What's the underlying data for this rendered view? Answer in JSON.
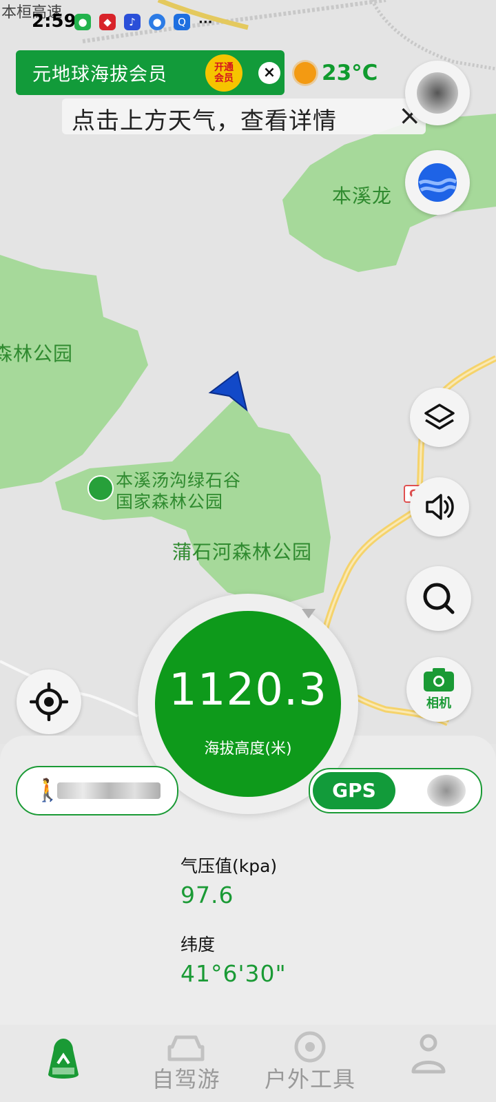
{
  "status_bar": {
    "time": "2:59",
    "more": "···",
    "icons": [
      "wechat-icon",
      "app-red-icon",
      "music-icon",
      "browser-icon",
      "search-app-icon"
    ]
  },
  "map": {
    "road_top": "本桓高速",
    "labels": {
      "benxi_long": "本溪龙",
      "forest_park_left": "森林公园",
      "poi_line1": "本溪汤沟绿石谷",
      "poi_line2": "国家森林公园",
      "pushihe": "蒲石河森林公园"
    },
    "road_shield": "G2"
  },
  "vip_banner": {
    "text": "元地球海拔会员",
    "badge": "开通会员",
    "close": "×"
  },
  "weather": {
    "temp": "23°C"
  },
  "tip_banner": {
    "text": "点击上方天气，查看详情",
    "close": "×"
  },
  "right_buttons": {
    "camera_label": "相机"
  },
  "gauge": {
    "value": "1120.3",
    "label": "海拔高度(米)"
  },
  "gps_toggle": {
    "label": "GPS"
  },
  "info": {
    "pressure_label": "气压值(kpa)",
    "pressure_value": "97.6",
    "latitude_label": "纬度",
    "latitude_value": "41°6'30\""
  },
  "nav": {
    "items": [
      {
        "label": ""
      },
      {
        "label": "自驾游"
      },
      {
        "label": "户外工具"
      },
      {
        "label": ""
      }
    ]
  },
  "colors": {
    "brand_green": "#129b3a",
    "park_green": "#a6d99a",
    "map_bg": "#e4e4e4",
    "sun_orange": "#f39a12"
  }
}
